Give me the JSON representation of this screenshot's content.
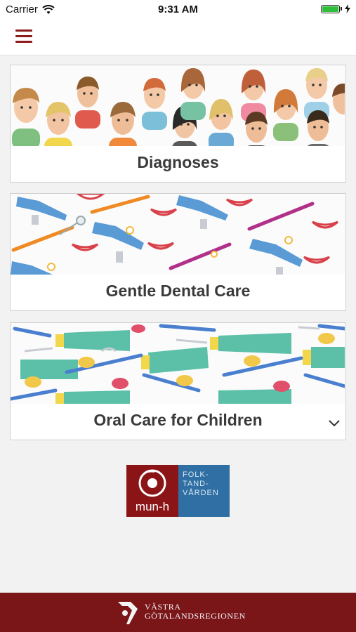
{
  "status_bar": {
    "carrier": "Carrier",
    "time": "9:31 AM",
    "icons": [
      "wifi-icon",
      "battery-icon",
      "charging-bolt-icon"
    ]
  },
  "nav": {
    "menu_icon": "hamburger-icon",
    "accent_color": "#8e1b1b"
  },
  "cards": [
    {
      "title": "Diagnoses",
      "image": "children-faces-illustration"
    },
    {
      "title": "Gentle Dental Care",
      "image": "dental-chairs-mouths-toothbrushes-illustration"
    },
    {
      "title": "Oral Care for Children",
      "image": "toothpaste-toothbrushes-pacifiers-illustration",
      "expand_icon": "chevron-down-icon"
    }
  ],
  "logo": {
    "left_text": "mun-h",
    "right_lines": [
      "FOLK-",
      "TAND-",
      "VÅRDEN"
    ],
    "colors": {
      "left": "#8b1416",
      "right": "#2f6fa3"
    }
  },
  "footer": {
    "line1": "VÄSTRA",
    "line2": "GÖTALANDSREGIONEN",
    "background": "#7a1518"
  }
}
